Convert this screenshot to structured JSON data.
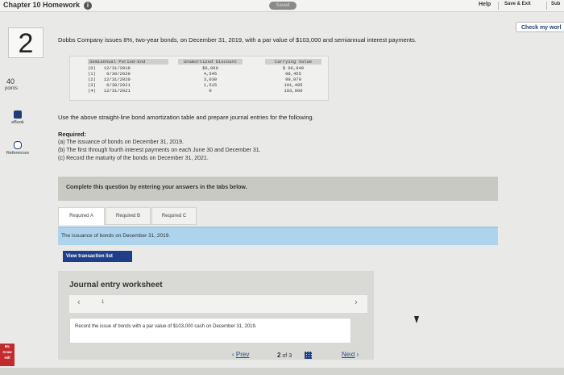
{
  "header": {
    "title": "Chapter 10 Homework",
    "saved": "Saved",
    "help": "Help",
    "save_exit": "Save & Exit",
    "submit": "Sub"
  },
  "check_work": "Check my worl",
  "question": {
    "number": "2",
    "points_value": "40",
    "points_label": "points",
    "text": "Dobbs Company issues 8%, two-year bonds, on December 31, 2019, with a par value of $103,000 and semiannual interest payments."
  },
  "tools": {
    "ebook": "eBook",
    "references": "References"
  },
  "table": {
    "headers": [
      "Semiannual Period-End",
      "Unamortized Discount",
      "Carrying Value"
    ],
    "rows": [
      {
        "idx": "(0)",
        "date": "12/31/2019",
        "discount": "$6,060",
        "carrying": "$ 96,940"
      },
      {
        "idx": "(1)",
        "date": "6/30/2020",
        "discount": "4,545",
        "carrying": "98,455"
      },
      {
        "idx": "(2)",
        "date": "12/31/2020",
        "discount": "3,030",
        "carrying": "99,970"
      },
      {
        "idx": "(3)",
        "date": "6/30/2021",
        "discount": "1,515",
        "carrying": "101,485"
      },
      {
        "idx": "(4)",
        "date": "12/31/2021",
        "discount": "0",
        "carrying": "103,000"
      }
    ]
  },
  "instructions": "Use the above straight-line bond amortization table and prepare journal entries for the following.",
  "required": {
    "title": "Required:",
    "items": [
      "(a) The issuance of bonds on December 31, 2019.",
      "(b) The first through fourth interest payments on each June 30 and December 31.",
      "(c) Record the maturity of the bonds on December 31, 2021."
    ]
  },
  "complete_prompt": "Complete this question by entering your answers in the tabs below.",
  "tabs": [
    "Required A",
    "Required B",
    "Required C"
  ],
  "tab_description": "The issuance of bonds on December 31, 2019.",
  "view_transaction_list": "View transaction list",
  "worksheet": {
    "title": "Journal entry worksheet",
    "page": "1",
    "instruction": "Record the issue of bonds with a par value of $103,000 cash on December 31, 2019."
  },
  "pager": {
    "prev": "Prev",
    "current": "2",
    "of": "of 3",
    "next": "Next"
  },
  "logo": {
    "line1": "Mc",
    "line2": "Graw",
    "line3": "Hill"
  }
}
